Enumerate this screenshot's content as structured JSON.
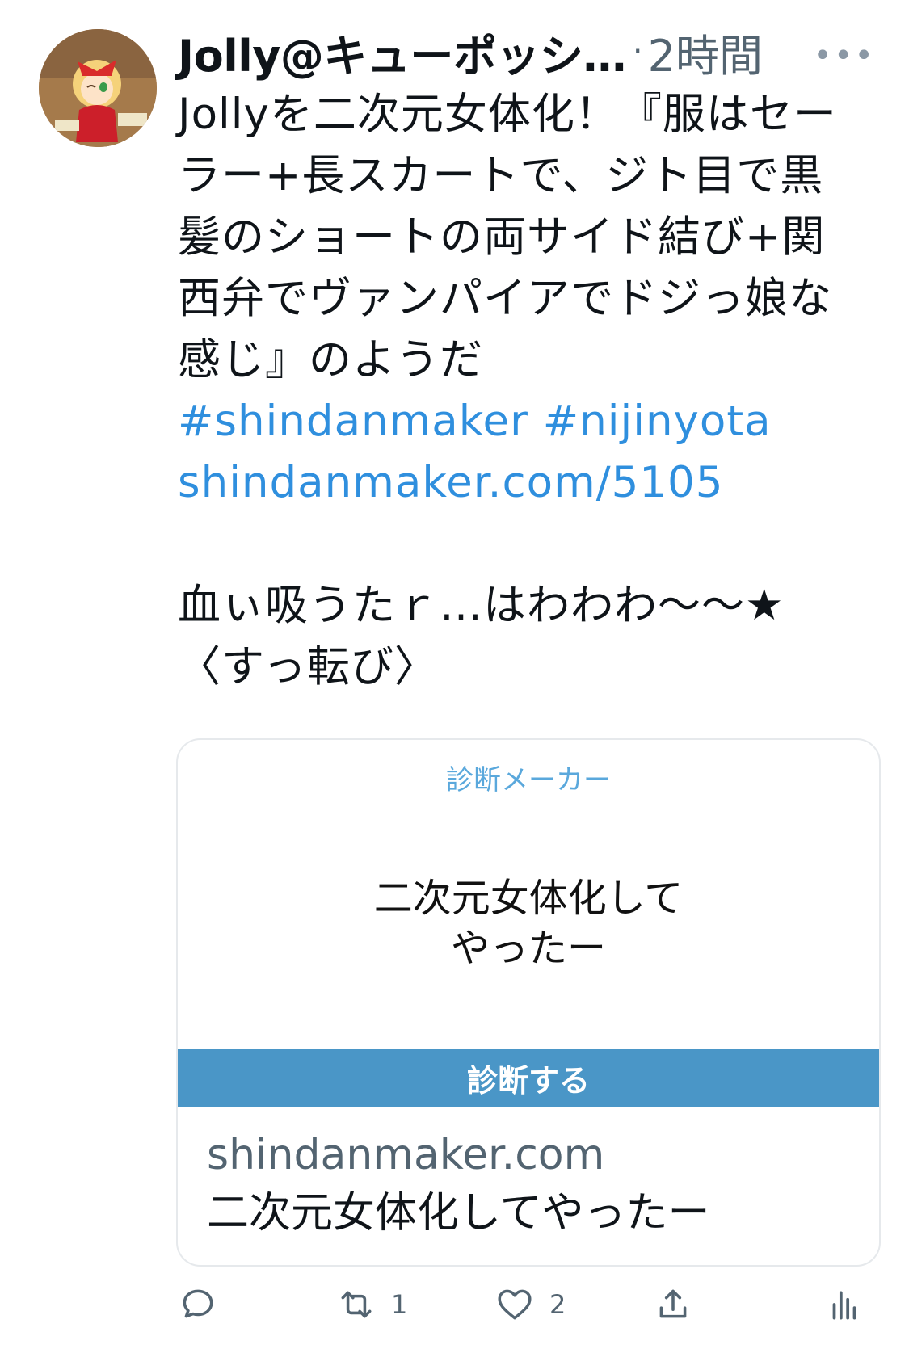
{
  "tweet": {
    "author": "Jolly@キューポッシ…",
    "separator": "·",
    "time": "2時間",
    "more": "•••",
    "lines": [
      "Jollyを二次元女体化！『服はセー",
      "ラー+長スカートで、ジト目で黒",
      "髪のショートの両サイド結び+関",
      "西弁でヴァンパイアでドジっ娘な",
      "感じ』のようだ"
    ],
    "hashtags": "#shindanmaker #nijinyota",
    "url": "shindanmaker.com/5105",
    "extra_lines": [
      "血ぃ吸うたｒ…はわわわ〜〜★",
      "〈すっ転び〉"
    ]
  },
  "card": {
    "site_name": "診断メーカー",
    "title_line1": "二次元女体化して",
    "title_line2": "やったー",
    "button": "診断する",
    "domain": "shindanmaker.com",
    "footer_title": "二次元女体化してやったー"
  },
  "actions": {
    "reply": {
      "icon": "reply-icon",
      "count": ""
    },
    "retweet": {
      "icon": "retweet-icon",
      "count": "1"
    },
    "like": {
      "icon": "heart-icon",
      "count": "2"
    },
    "share": {
      "icon": "share-icon"
    },
    "analytics": {
      "icon": "analytics-icon"
    }
  },
  "colors": {
    "link": "#2f8fde",
    "muted": "#536471",
    "card_button": "#4a96c7",
    "card_site": "#5aa8dc"
  }
}
